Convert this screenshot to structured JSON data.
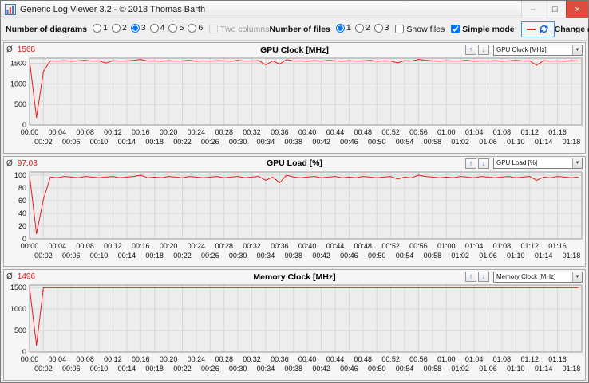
{
  "window": {
    "title": "Generic Log Viewer 3.2 - © 2018 Thomas Barth",
    "minimize_glyph": "–",
    "maximize_glyph": "□",
    "close_glyph": "×"
  },
  "toolbar": {
    "number_of_diagrams_label": "Number of diagrams",
    "diagram_count_options": [
      "1",
      "2",
      "3",
      "4",
      "5",
      "6"
    ],
    "diagram_count_selected": "3",
    "two_columns_label": "Two columns",
    "two_columns_checked": false,
    "two_columns_enabled": false,
    "number_of_files_label": "Number of files",
    "file_count_options": [
      "1",
      "2",
      "3"
    ],
    "file_count_selected": "1",
    "show_files_label": "Show files",
    "show_files_checked": false,
    "simple_mode_label": "Simple mode",
    "simple_mode_checked": true,
    "change_all_label": "Change all"
  },
  "chart_data": [
    {
      "type": "line",
      "title": "GPU Clock [MHz]",
      "avg_symbol": "Ø",
      "avg_value": "1568",
      "dropdown_value": "GPU Clock [MHz]",
      "line_color": "#f01818",
      "ylim": [
        0,
        1625
      ],
      "yticks": [
        0,
        500,
        1000,
        1500
      ],
      "x_minutes_max": 79.5,
      "x_tick_step": 2,
      "x_tick_labels_row1": [
        "00:00",
        "00:04",
        "00:08",
        "00:12",
        "00:16",
        "00:20",
        "00:24",
        "00:28",
        "00:32",
        "00:36",
        "00:40",
        "00:44",
        "00:48",
        "00:52",
        "00:56",
        "01:00",
        "01:04",
        "01:08",
        "01:12",
        "01:16"
      ],
      "x_tick_labels_row2": [
        "00:02",
        "00:06",
        "00:10",
        "00:14",
        "00:18",
        "00:22",
        "00:26",
        "00:30",
        "00:34",
        "00:38",
        "00:42",
        "00:46",
        "00:50",
        "00:54",
        "00:58",
        "01:02",
        "01:06",
        "01:10",
        "01:14",
        "01:18"
      ],
      "values_per_minute": [
        1568,
        180,
        1300,
        1560,
        1555,
        1565,
        1550,
        1560,
        1570,
        1555,
        1560,
        1505,
        1565,
        1555,
        1560,
        1570,
        1595,
        1555,
        1560,
        1550,
        1565,
        1555,
        1560,
        1570,
        1550,
        1560,
        1555,
        1565,
        1560,
        1550,
        1570,
        1555,
        1560,
        1565,
        1460,
        1555,
        1480,
        1590,
        1555,
        1560,
        1550,
        1565,
        1555,
        1570,
        1560,
        1550,
        1565,
        1555,
        1560,
        1570,
        1550,
        1560,
        1555,
        1510,
        1565,
        1555,
        1595,
        1575,
        1560,
        1550,
        1565,
        1555,
        1560,
        1570,
        1550,
        1560,
        1555,
        1565,
        1550,
        1560,
        1570,
        1555,
        1560,
        1450,
        1565,
        1555,
        1560,
        1550,
        1565,
        1558
      ]
    },
    {
      "type": "line",
      "title": "GPU Load [%]",
      "avg_symbol": "Ø",
      "avg_value": "97.03",
      "dropdown_value": "GPU Load [%]",
      "line_color": "#f01818",
      "ylim": [
        0,
        105
      ],
      "yticks": [
        0,
        20,
        40,
        60,
        80,
        100
      ],
      "x_minutes_max": 79.5,
      "x_tick_step": 2,
      "x_tick_labels_row1": [
        "00:00",
        "00:04",
        "00:08",
        "00:12",
        "00:16",
        "00:20",
        "00:24",
        "00:28",
        "00:32",
        "00:36",
        "00:40",
        "00:44",
        "00:48",
        "00:52",
        "00:56",
        "01:00",
        "01:04",
        "01:08",
        "01:12",
        "01:16"
      ],
      "x_tick_labels_row2": [
        "00:02",
        "00:06",
        "00:10",
        "00:14",
        "00:18",
        "00:22",
        "00:26",
        "00:30",
        "00:34",
        "00:38",
        "00:42",
        "00:46",
        "00:50",
        "00:54",
        "00:58",
        "01:02",
        "01:06",
        "01:10",
        "01:14",
        "01:18"
      ],
      "values_per_minute": [
        100,
        8,
        62,
        97,
        96,
        98,
        97,
        96,
        98,
        97,
        96,
        97,
        98,
        96,
        97,
        98,
        100,
        96,
        97,
        96,
        98,
        97,
        96,
        98,
        97,
        96,
        97,
        98,
        96,
        97,
        98,
        96,
        97,
        98,
        92,
        97,
        88,
        100,
        97,
        96,
        97,
        98,
        96,
        97,
        98,
        96,
        97,
        96,
        98,
        97,
        96,
        97,
        98,
        94,
        97,
        96,
        100,
        98,
        97,
        96,
        97,
        96,
        98,
        97,
        96,
        98,
        97,
        96,
        97,
        98,
        96,
        97,
        98,
        92,
        97,
        96,
        98,
        97,
        96,
        97
      ]
    },
    {
      "type": "line",
      "title": "Memory Clock [MHz]",
      "avg_symbol": "Ø",
      "avg_value": "1496",
      "dropdown_value": "Memory Clock [MHz]",
      "line_color": "#f01818",
      "ylim": [
        0,
        1560
      ],
      "yticks": [
        0,
        500,
        1000,
        1500
      ],
      "x_minutes_max": 79.5,
      "x_tick_step": 2,
      "x_tick_labels_row1": [
        "00:00",
        "00:04",
        "00:08",
        "00:12",
        "00:16",
        "00:20",
        "00:24",
        "00:28",
        "00:32",
        "00:36",
        "00:40",
        "00:44",
        "00:48",
        "00:52",
        "00:56",
        "01:00",
        "01:04",
        "01:08",
        "01:12",
        "01:16"
      ],
      "x_tick_labels_row2": [
        "00:02",
        "00:06",
        "00:10",
        "00:14",
        "00:18",
        "00:22",
        "00:26",
        "00:30",
        "00:34",
        "00:38",
        "00:42",
        "00:46",
        "00:50",
        "00:54",
        "00:58",
        "01:02",
        "01:06",
        "01:10",
        "01:14",
        "01:18"
      ],
      "values_per_minute": [
        1500,
        150,
        1496,
        1496,
        1496,
        1497,
        1496,
        1496,
        1496,
        1496,
        1496,
        1496,
        1497,
        1496,
        1496,
        1496,
        1496,
        1496,
        1496,
        1496,
        1496,
        1497,
        1496,
        1496,
        1496,
        1496,
        1496,
        1496,
        1497,
        1496,
        1496,
        1496,
        1496,
        1496,
        1496,
        1496,
        1496,
        1497,
        1496,
        1496,
        1496,
        1496,
        1497,
        1496,
        1496,
        1496,
        1496,
        1496,
        1496,
        1496,
        1496,
        1496,
        1496,
        1497,
        1496,
        1496,
        1496,
        1496,
        1496,
        1496,
        1497,
        1496,
        1496,
        1496,
        1496,
        1496,
        1496,
        1496,
        1496,
        1497,
        1496,
        1496,
        1496,
        1496,
        1496,
        1496,
        1497,
        1496,
        1496,
        1496
      ]
    }
  ]
}
